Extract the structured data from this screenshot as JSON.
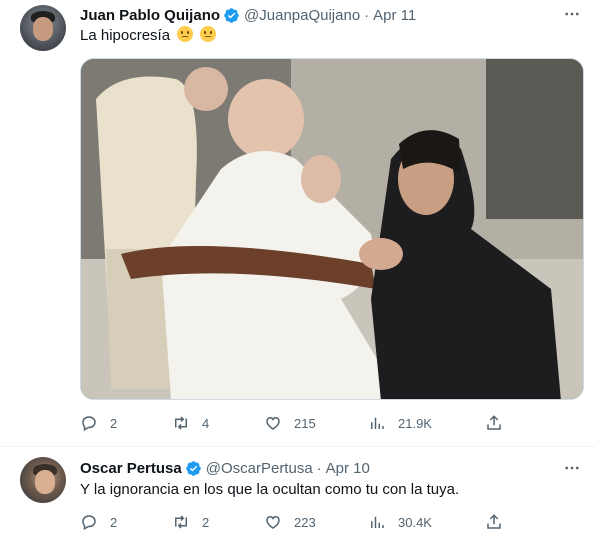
{
  "tweets": [
    {
      "author": {
        "name": "Juan Pablo Quijano",
        "handle": "@JuanpaQuijano"
      },
      "date": "Apr 11",
      "text": "La hipocresía",
      "emojis": [
        "confused-face-emoji",
        "smiling-face-emoji"
      ],
      "media": {
        "kind": "photo"
      },
      "stats": {
        "replies": "2",
        "reposts": "4",
        "likes": "215",
        "views": "21.9K"
      }
    },
    {
      "author": {
        "name": "Oscar Pertusa",
        "handle": "@OscarPertusa"
      },
      "date": "Apr 10",
      "text": "Y la ignorancia en los que la ocultan como tu con la tuya.",
      "stats": {
        "replies": "2",
        "reposts": "2",
        "likes": "223",
        "views": "30.4K"
      }
    }
  ],
  "separator": "·",
  "colors": {
    "verified": "#1d9bf0",
    "text": "#0f1419",
    "secondary": "#536471",
    "border": "#eff3f4"
  },
  "icons": [
    "reply-icon",
    "repost-icon",
    "like-icon",
    "views-icon",
    "share-icon",
    "more-icon",
    "verified-badge-icon"
  ]
}
